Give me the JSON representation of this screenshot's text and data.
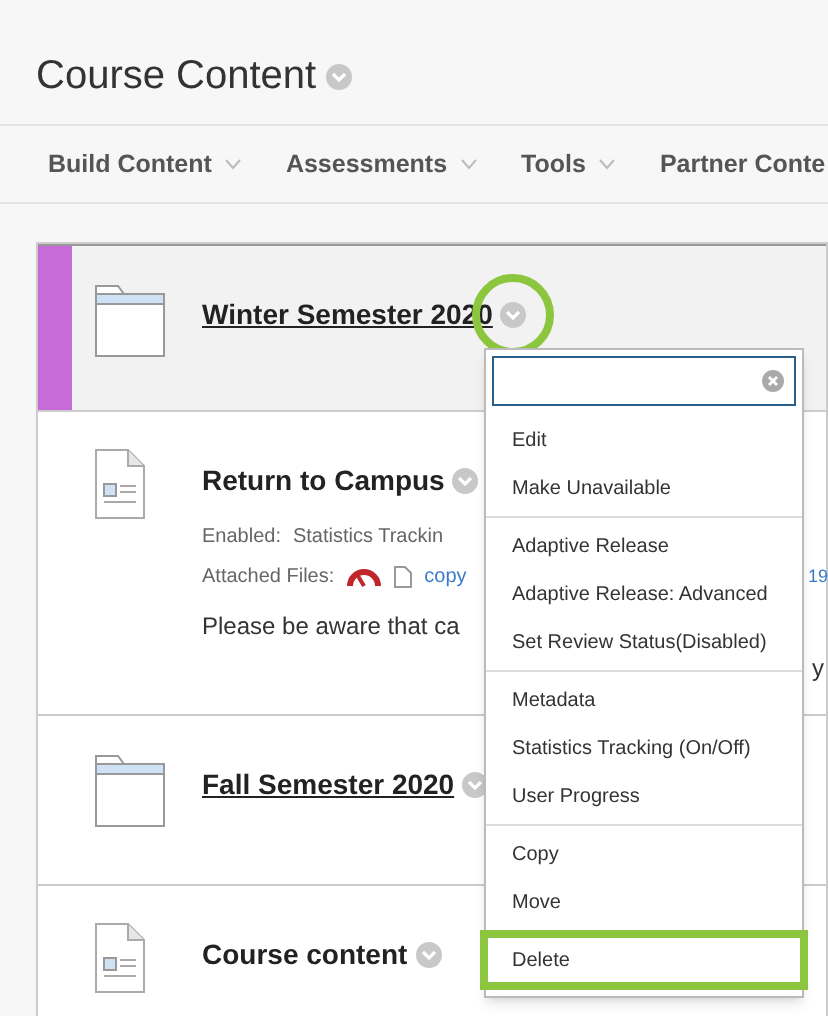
{
  "page": {
    "title": "Course Content"
  },
  "toolbar": [
    {
      "label": "Build Content"
    },
    {
      "label": "Assessments"
    },
    {
      "label": "Tools"
    },
    {
      "label": "Partner Conte"
    }
  ],
  "items": [
    {
      "kind": "folder",
      "title": "Winter Semester 2020",
      "selected": true,
      "callout": true
    },
    {
      "kind": "document",
      "title": "Return to Campus",
      "selected": false,
      "callout": false,
      "details": [
        {
          "label": "Enabled:",
          "value": "Statistics Trackin"
        },
        {
          "label": "Attached Files:",
          "file": "copy",
          "overflow": "19"
        }
      ],
      "body": "Please be aware that ca",
      "body_overflow": "y"
    },
    {
      "kind": "folder",
      "title": "Fall Semester 2020",
      "selected": false,
      "callout": false
    },
    {
      "kind": "document",
      "title": "Course content",
      "selected": false,
      "callout": false
    }
  ],
  "menu": {
    "groups": [
      [
        {
          "label": "Edit",
          "highlighted": false
        },
        {
          "label": "Make Unavailable",
          "highlighted": false
        }
      ],
      [
        {
          "label": "Adaptive Release",
          "highlighted": false
        },
        {
          "label": "Adaptive Release: Advanced",
          "highlighted": false
        },
        {
          "label": "Set Review Status(Disabled)",
          "highlighted": false
        }
      ],
      [
        {
          "label": "Metadata",
          "highlighted": false
        },
        {
          "label": "Statistics Tracking (On/Off)",
          "highlighted": false
        },
        {
          "label": "User Progress",
          "highlighted": false
        }
      ],
      [
        {
          "label": "Copy",
          "highlighted": false
        },
        {
          "label": "Move",
          "highlighted": false
        }
      ],
      [
        {
          "label": "Delete",
          "highlighted": true
        }
      ]
    ]
  }
}
